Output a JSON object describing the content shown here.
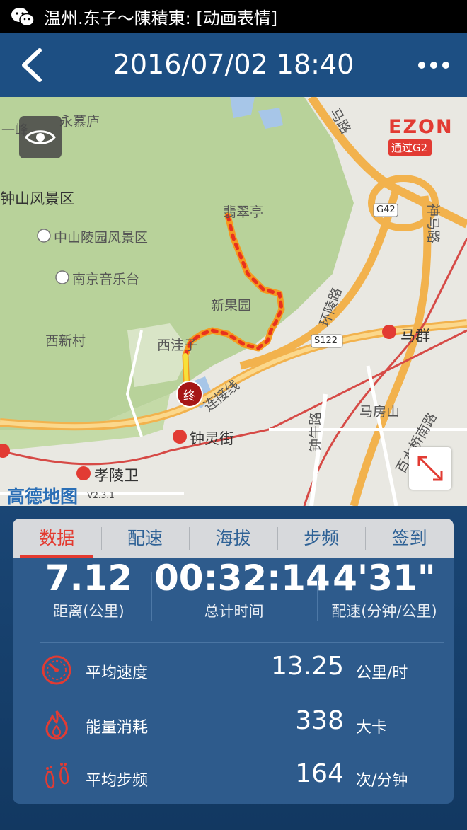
{
  "status_bar": {
    "text": "温州.东子～陳積東: [动画表情]",
    "icon": "wechat-icon"
  },
  "header": {
    "title": "2016/07/02 18:40",
    "back_icon": "back-chevron-icon",
    "more_icon": "more-dots-icon"
  },
  "map": {
    "labels": {
      "yongmulu": "永慕庐",
      "yifeng": "一峰",
      "zhongshan": "钟山风景区",
      "zhongshanling": "中山陵园风景区",
      "yinyuetai": "南京音乐台",
      "xixincun": "西新村",
      "feicuiting": "翡翠亭",
      "xinguoyuan": "新果园",
      "xizhenglu": "西洼子",
      "lianjiexian": "连接线",
      "zhonglingjie": "钟灵街",
      "xiaolingwei": "孝陵卫",
      "maqun": "马群",
      "mafangshan": "马房山",
      "zhongniulu": "钟牛路",
      "huanlinglu": "环陵路",
      "baishuiqiao": "百水桥南路",
      "shenmalu": "神马路",
      "malu": "马路",
      "s122": "S122",
      "g42": "G42",
      "end_marker": "终",
      "amap": "高德地图",
      "amap_version": "V2.3.1"
    },
    "brand": {
      "name": "EZON",
      "badge": "通过G2"
    },
    "route_colors": {
      "hot": "#e8321e",
      "warm": "#f59a20",
      "cool": "#f7e03a"
    }
  },
  "tabs": [
    "数据",
    "配速",
    "海拔",
    "步频",
    "签到"
  ],
  "active_tab": 0,
  "summary": {
    "distance": {
      "value": "7.12",
      "label": "距离(公里)"
    },
    "time": {
      "value": "00:32:14",
      "label": "总计时间"
    },
    "pace": {
      "value": "4'31\"",
      "label": "配速(分钟/公里)"
    }
  },
  "stats": [
    {
      "icon": "speedometer-icon",
      "name": "平均速度",
      "value": "13.25",
      "unit": "公里/时"
    },
    {
      "icon": "flame-icon",
      "name": "能量消耗",
      "value": "338",
      "unit": "大卡"
    },
    {
      "icon": "footprints-icon",
      "name": "平均步频",
      "value": "164",
      "unit": "次/分钟"
    }
  ],
  "colors": {
    "accent": "#e33a30",
    "header": "#1d4f83",
    "panel": "#2e5b8c",
    "tab_bar": "#d7d9dc",
    "tab_text": "#2f6296"
  }
}
